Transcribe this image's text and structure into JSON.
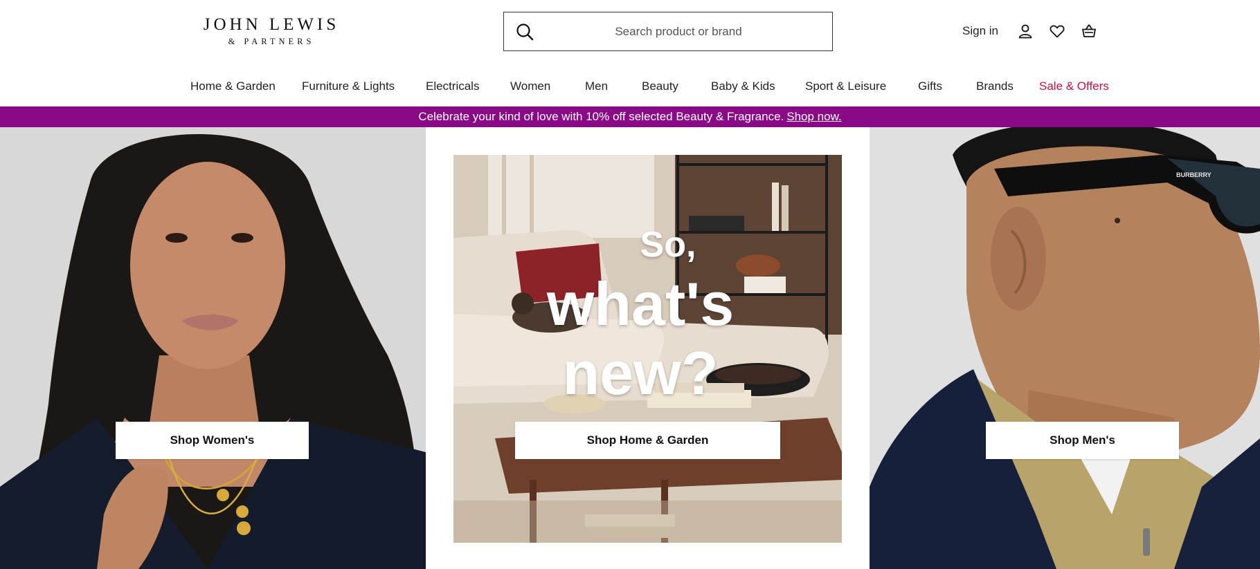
{
  "brand": {
    "name_line1": "JOHN LEWIS",
    "name_line2": "& PARTNERS"
  },
  "search": {
    "placeholder": "Search product or brand",
    "icon": "search-icon"
  },
  "account": {
    "signin_label": "Sign in",
    "icons": [
      "user-icon",
      "heart-icon",
      "basket-icon"
    ]
  },
  "nav": {
    "items": [
      "Home & Garden",
      "Furniture & Lights",
      "Electricals",
      "Women",
      "Men",
      "Beauty",
      "Baby & Kids",
      "Sport & Leisure",
      "Gifts",
      "Brands",
      "Sale & Offers"
    ]
  },
  "promo": {
    "text": "Celebrate your kind of love with 10% off selected Beauty & Fragrance.",
    "link": "Shop now.",
    "background": "#8a0986"
  },
  "hero": {
    "women_cta": "Shop Women's",
    "home_cta": "Shop Home & Garden",
    "men_cta": "Shop Men's",
    "headline_line1": "So,",
    "headline_line2": "what's",
    "headline_line3": "new?",
    "sunglasses_brand": "BURBERRY"
  },
  "colors": {
    "sale": "#c4103f",
    "promo": "#8a0986",
    "text": "#1a1a1a"
  }
}
